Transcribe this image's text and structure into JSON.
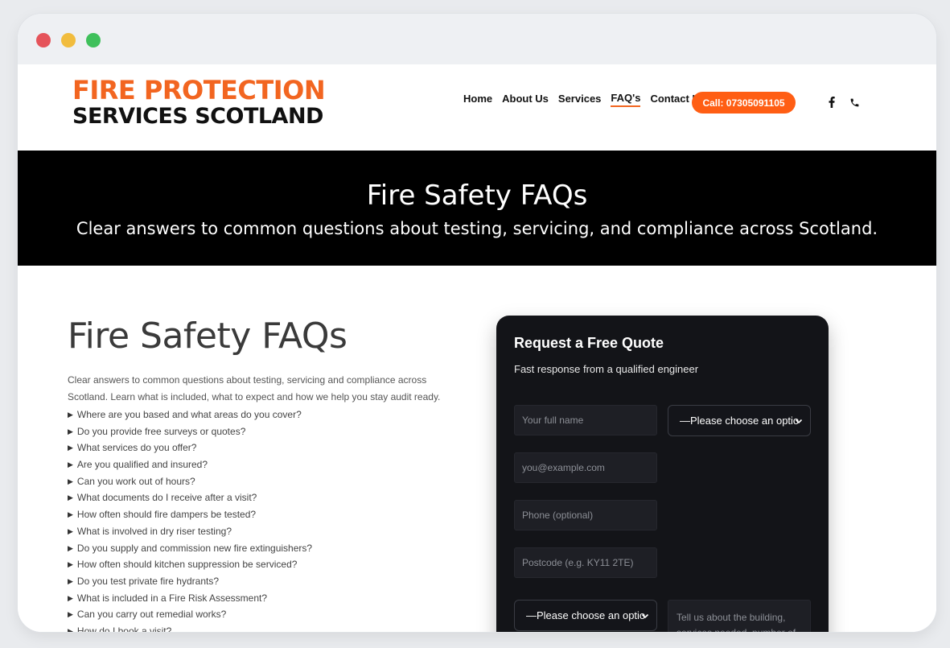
{
  "header": {
    "logo_line1": "FIRE PROTECTION",
    "logo_line2": "SERVICES SCOTLAND",
    "nav": [
      "Home",
      "About Us",
      "Services",
      "FAQ's",
      "Contact Us"
    ],
    "active_nav": "FAQ's",
    "call_button": "Call: 07305091105",
    "social_icons": [
      "facebook-icon",
      "phone-icon"
    ]
  },
  "hero": {
    "title": "Fire Safety FAQs",
    "subtitle": "Clear answers to common questions about testing, servicing, and compliance across Scotland."
  },
  "faq": {
    "title": "Fire Safety FAQs",
    "intro": "Clear answers to common questions about testing, servicing and compliance across Scotland. Learn what is included, what to expect and how we help you stay audit ready.",
    "questions": [
      "Where are you based and what areas do you cover?",
      "Do you provide free surveys or quotes?",
      "What services do you offer?",
      "Are you qualified and insured?",
      "Can you work out of hours?",
      "What documents do I receive after a visit?",
      "How often should fire dampers be tested?",
      "What is involved in dry riser testing?",
      "Do you supply and commission new fire extinguishers?",
      "How often should kitchen suppression be serviced?",
      "Do you test private fire hydrants?",
      "What is included in a Fire Risk Assessment?",
      "Can you carry out remedial works?",
      "How do I book a visit?"
    ]
  },
  "quote_form": {
    "title": "Request a Free Quote",
    "subtitle": "Fast response from a qualified engineer",
    "name_placeholder": "Your full name",
    "email_placeholder": "you@example.com",
    "phone_placeholder": "Phone (optional)",
    "postcode_placeholder": "Postcode (e.g. KY11 2TE)",
    "select1_value": "—Please choose an optio",
    "select2_value": "—Please choose an optio",
    "message_placeholder": "Tell us about the building, services needed, number of"
  },
  "colors": {
    "accent": "#ff5e14",
    "logo_orange": "#f26520",
    "hero_bg": "#000000",
    "card_bg": "#131418"
  }
}
